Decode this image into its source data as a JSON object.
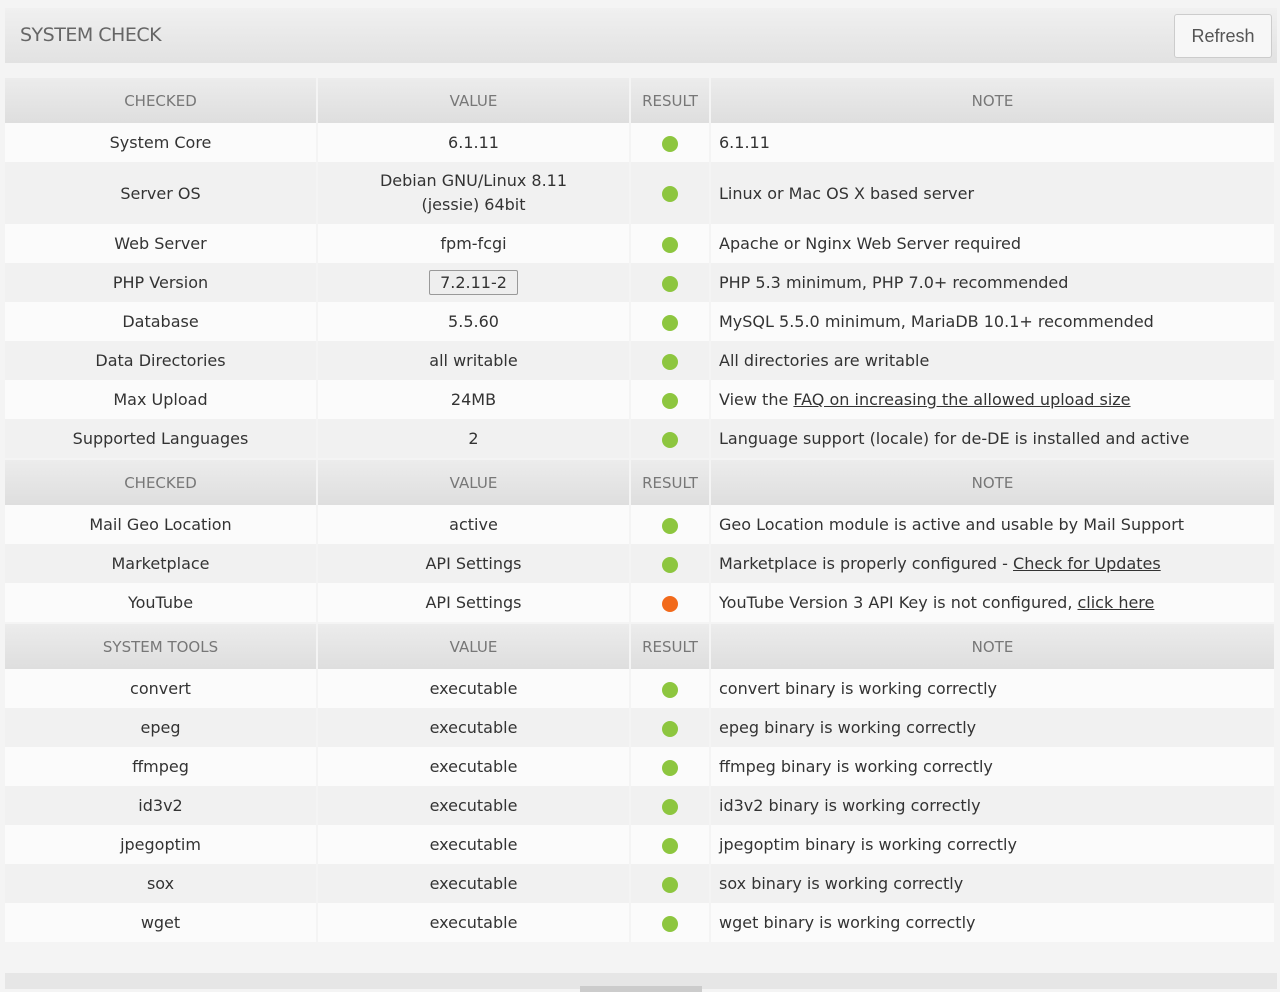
{
  "header": {
    "title": "SYSTEM CHECK",
    "refresh_label": "Refresh"
  },
  "colors": {
    "ok": "#8dc63f",
    "warn": "#f26a1b"
  },
  "sections": [
    {
      "headers": [
        "CHECKED",
        "VALUE",
        "RESULT",
        "NOTE"
      ],
      "rows": [
        {
          "checked": "System Core",
          "value": "6.1.11",
          "status": "ok",
          "note": "6.1.11"
        },
        {
          "checked": "Server OS",
          "value": "Debian GNU/Linux 8.11 (jessie) 64bit",
          "status": "ok",
          "note": "Linux or Mac OS X based server"
        },
        {
          "checked": "Web Server",
          "value": "fpm-fcgi",
          "status": "ok",
          "note": "Apache or Nginx Web Server required"
        },
        {
          "checked": "PHP Version",
          "value": "7.2.11-2",
          "boxed": true,
          "status": "ok",
          "note": "PHP 5.3 minimum, PHP 7.0+ recommended"
        },
        {
          "checked": "Database",
          "value": "5.5.60",
          "status": "ok",
          "note": "MySQL 5.5.0 minimum, MariaDB 10.1+ recommended"
        },
        {
          "checked": "Data Directories",
          "value": "all writable",
          "status": "ok",
          "note": "All directories are writable"
        },
        {
          "checked": "Max Upload",
          "value": "24MB",
          "status": "ok",
          "note": "View the ",
          "link": "FAQ on increasing the allowed upload size"
        },
        {
          "checked": "Supported Languages",
          "value": "2",
          "status": "ok",
          "note": "Language support (locale) for de-DE is installed and active"
        }
      ]
    },
    {
      "headers": [
        "CHECKED",
        "VALUE",
        "RESULT",
        "NOTE"
      ],
      "rows": [
        {
          "checked": "Mail Geo Location",
          "value": "active",
          "status": "ok",
          "note": "Geo Location module is active and usable by Mail Support"
        },
        {
          "checked": "Marketplace",
          "value": "API Settings",
          "status": "ok",
          "note": "Marketplace is properly configured - ",
          "link": "Check for Updates"
        },
        {
          "checked": "YouTube",
          "value": "API Settings",
          "status": "warn",
          "note": "YouTube Version 3 API Key is not configured, ",
          "link": "click here"
        }
      ]
    },
    {
      "headers": [
        "SYSTEM TOOLS",
        "VALUE",
        "RESULT",
        "NOTE"
      ],
      "rows": [
        {
          "checked": "convert",
          "value": "executable",
          "status": "ok",
          "note": "convert binary is working correctly"
        },
        {
          "checked": "epeg",
          "value": "executable",
          "status": "ok",
          "note": "epeg binary is working correctly"
        },
        {
          "checked": "ffmpeg",
          "value": "executable",
          "status": "ok",
          "note": "ffmpeg binary is working correctly"
        },
        {
          "checked": "id3v2",
          "value": "executable",
          "status": "ok",
          "note": "id3v2 binary is working correctly"
        },
        {
          "checked": "jpegoptim",
          "value": "executable",
          "status": "ok",
          "note": "jpegoptim binary is working correctly"
        },
        {
          "checked": "sox",
          "value": "executable",
          "status": "ok",
          "note": "sox binary is working correctly"
        },
        {
          "checked": "wget",
          "value": "executable",
          "status": "ok",
          "note": "wget binary is working correctly"
        }
      ]
    }
  ]
}
